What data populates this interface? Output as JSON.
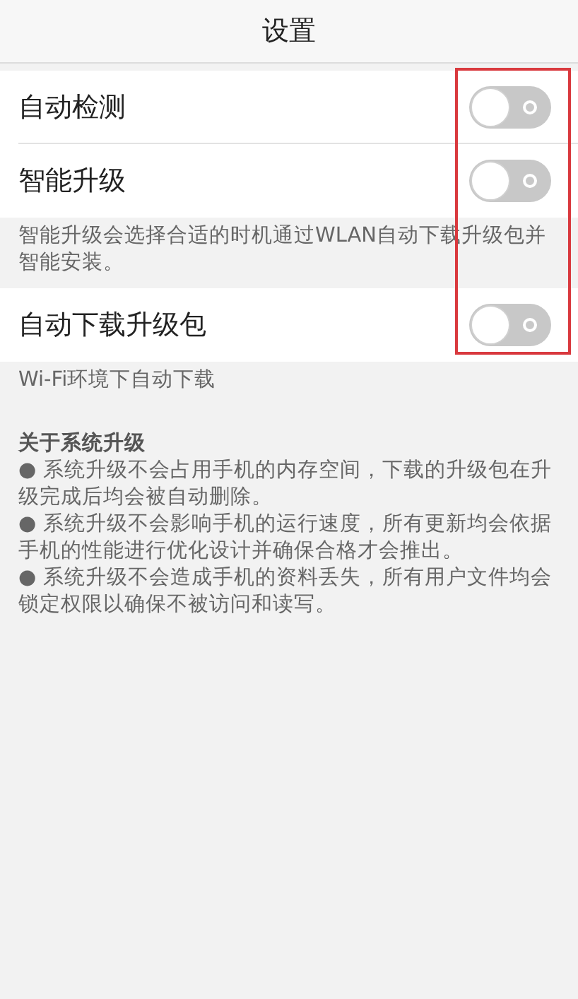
{
  "header": {
    "title": "设置"
  },
  "settings": [
    {
      "kind": "toggle",
      "label": "自动检测",
      "checked": false
    },
    {
      "kind": "toggle",
      "label": "智能升级",
      "checked": false
    },
    {
      "kind": "note",
      "text": "智能升级会选择合适的时机通过WLAN自动下载升级包并智能安装。"
    },
    {
      "kind": "toggle",
      "label": "自动下载升级包",
      "checked": false
    },
    {
      "kind": "note",
      "text": "Wi-Fi环境下自动下载"
    }
  ],
  "about": {
    "title": "关于系统升级",
    "points": [
      "● 系统升级不会占用手机的内存空间，下载的升级包在升级完成后均会被自动删除。",
      "● 系统升级不会影响手机的运行速度，所有更新均会依据手机的性能进行优化设计并确保合格才会推出。",
      "● 系统升级不会造成手机的资料丢失，所有用户文件均会锁定权限以确保不被访问和读写。"
    ]
  }
}
